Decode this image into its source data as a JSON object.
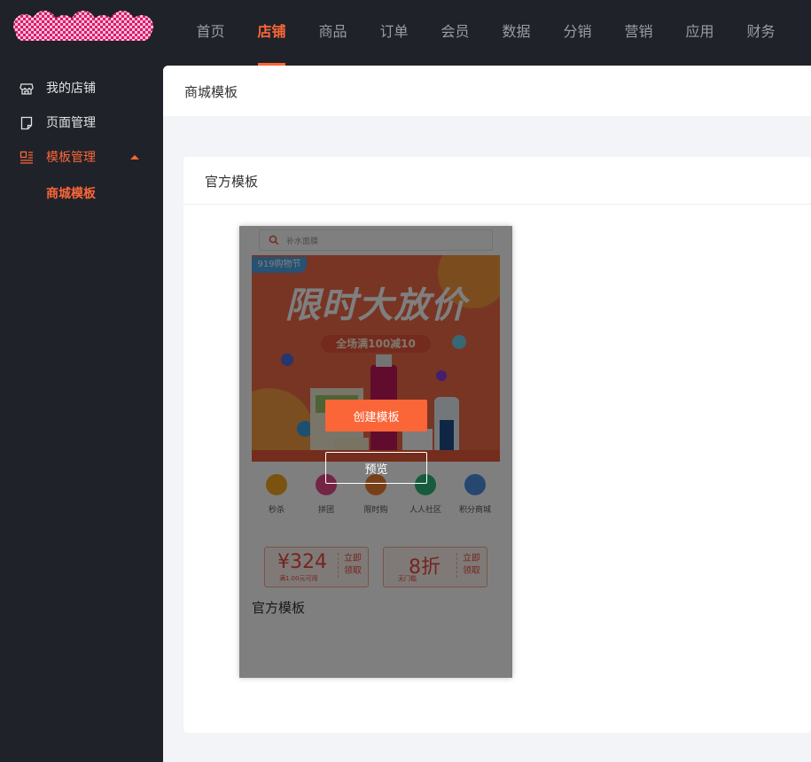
{
  "brand": {
    "logo_icon": "checkered-hearts-logo",
    "accent": "#fb6638"
  },
  "nav": {
    "items": [
      {
        "label": "首页",
        "active": false
      },
      {
        "label": "店铺",
        "active": true
      },
      {
        "label": "商品",
        "active": false
      },
      {
        "label": "订单",
        "active": false
      },
      {
        "label": "会员",
        "active": false
      },
      {
        "label": "数据",
        "active": false
      },
      {
        "label": "分销",
        "active": false
      },
      {
        "label": "营销",
        "active": false
      },
      {
        "label": "应用",
        "active": false
      },
      {
        "label": "财务",
        "active": false
      }
    ]
  },
  "sidebar": {
    "items": [
      {
        "label": "我的店铺",
        "icon": "store-icon"
      },
      {
        "label": "页面管理",
        "icon": "page-icon"
      },
      {
        "label": "模板管理",
        "icon": "template-icon",
        "expanded": true
      }
    ],
    "sub_items": [
      {
        "label": "商城模板",
        "active": true
      }
    ]
  },
  "page": {
    "title": "商城模板"
  },
  "panel": {
    "title": "官方模板"
  },
  "template_card": {
    "name": "官方模板",
    "create_label": "创建模板",
    "preview_label": "预览",
    "preview": {
      "search_placeholder": "补水面膜",
      "banner_tag": "919购物节",
      "banner_title": "限时大放价",
      "banner_subtitle": "全场满100减10",
      "shortcuts": [
        {
          "label": "秒杀",
          "color": "#f5a623"
        },
        {
          "label": "拼团",
          "color": "#e64b8a"
        },
        {
          "label": "限时购",
          "color": "#f08030"
        },
        {
          "label": "人人社区",
          "color": "#2fb67a"
        },
        {
          "label": "积分商城",
          "color": "#4a8fe0"
        }
      ],
      "coupons": [
        {
          "value": "¥324",
          "note": "满1.00元可用",
          "action": "立即领取"
        },
        {
          "value": "8折",
          "note": "无门槛",
          "action": "立即领取"
        }
      ]
    }
  }
}
